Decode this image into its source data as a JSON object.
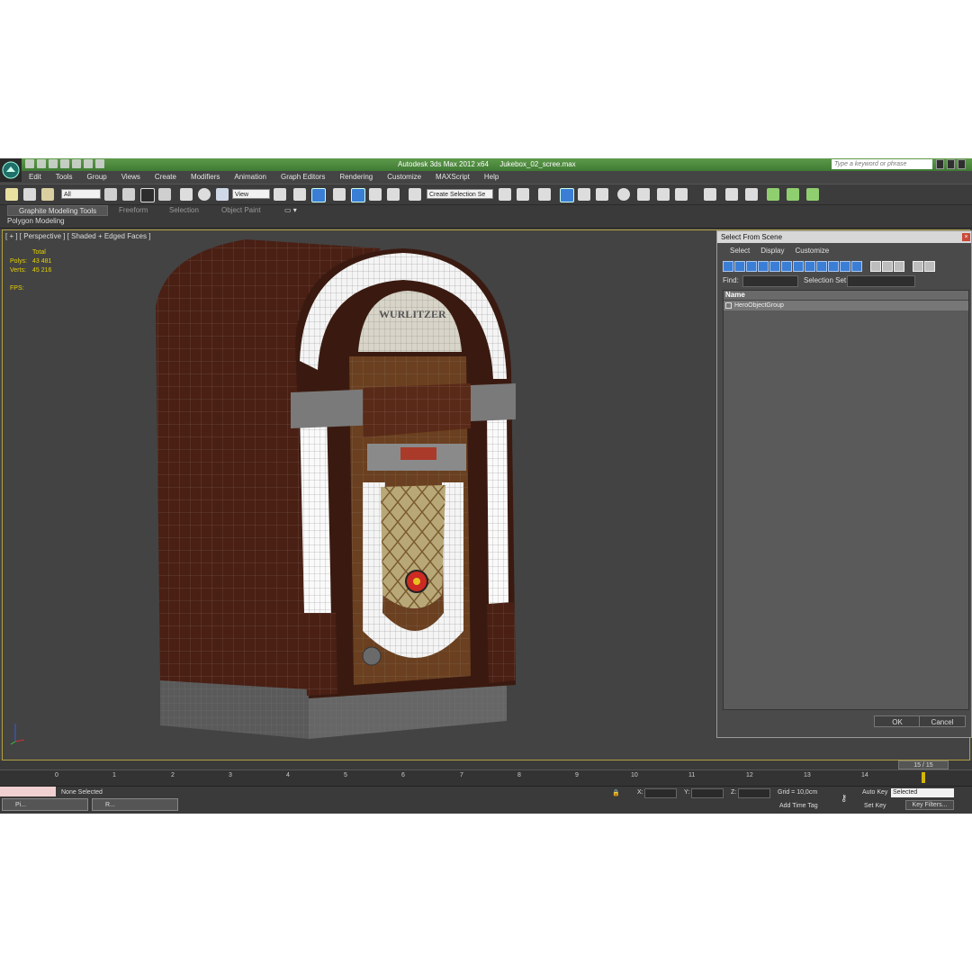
{
  "window": {
    "app_title": "Autodesk 3ds Max  2012 x64",
    "file_title": "Jukebox_02_scree.max",
    "search_placeholder": "Type a keyword or phrase"
  },
  "menu": [
    "Edit",
    "Tools",
    "Group",
    "Views",
    "Create",
    "Modifiers",
    "Animation",
    "Graph Editors",
    "Rendering",
    "Customize",
    "MAXScript",
    "Help"
  ],
  "toolbar": {
    "filter_value": "All",
    "ref_coord_value": "View",
    "selection_set_placeholder": "Create Selection Se"
  },
  "ribbon": {
    "tabs": [
      "Graphite Modeling Tools",
      "Freeform",
      "Selection",
      "Object Paint"
    ],
    "panel_label": "Polygon Modeling"
  },
  "viewport": {
    "label": "[ + ] [ Perspective ] [ Shaded + Edged Faces ]",
    "stats_header": "Total",
    "polys_label": "Polys:",
    "polys_value": "43 481",
    "verts_label": "Verts:",
    "verts_value": "45 216",
    "fps_label": "FPS:",
    "logo_text": "WURLITZER"
  },
  "dialog": {
    "title": "Select From Scene",
    "menu": [
      "Select",
      "Display",
      "Customize"
    ],
    "find_label": "Find:",
    "selection_set_label": "Selection Set:",
    "column_name": "Name",
    "items": [
      "HeroObjectGroup"
    ],
    "ok_label": "OK",
    "cancel_label": "Cancel"
  },
  "timeline": {
    "frame_readout": "15 / 15",
    "ticks": [
      "0",
      "1",
      "2",
      "3",
      "4",
      "5",
      "6",
      "7",
      "8",
      "9",
      "10",
      "11",
      "12",
      "13",
      "14"
    ]
  },
  "status": {
    "message": "None Selected",
    "x_label": "X:",
    "y_label": "Y:",
    "z_label": "Z:",
    "grid": "Grid = 10,0cm",
    "add_time_tag": "Add Time Tag",
    "auto_key": "Auto Key",
    "set_key": "Set Key",
    "selected_value": "Selected",
    "key_filters": "Key Filters..."
  },
  "taskbar": {
    "item1": "Pi...",
    "item2": "R..."
  },
  "colors": {
    "title_green": "#4f8c3e",
    "stats_yellow": "#e6d200",
    "viewport_border": "#b0a040"
  }
}
